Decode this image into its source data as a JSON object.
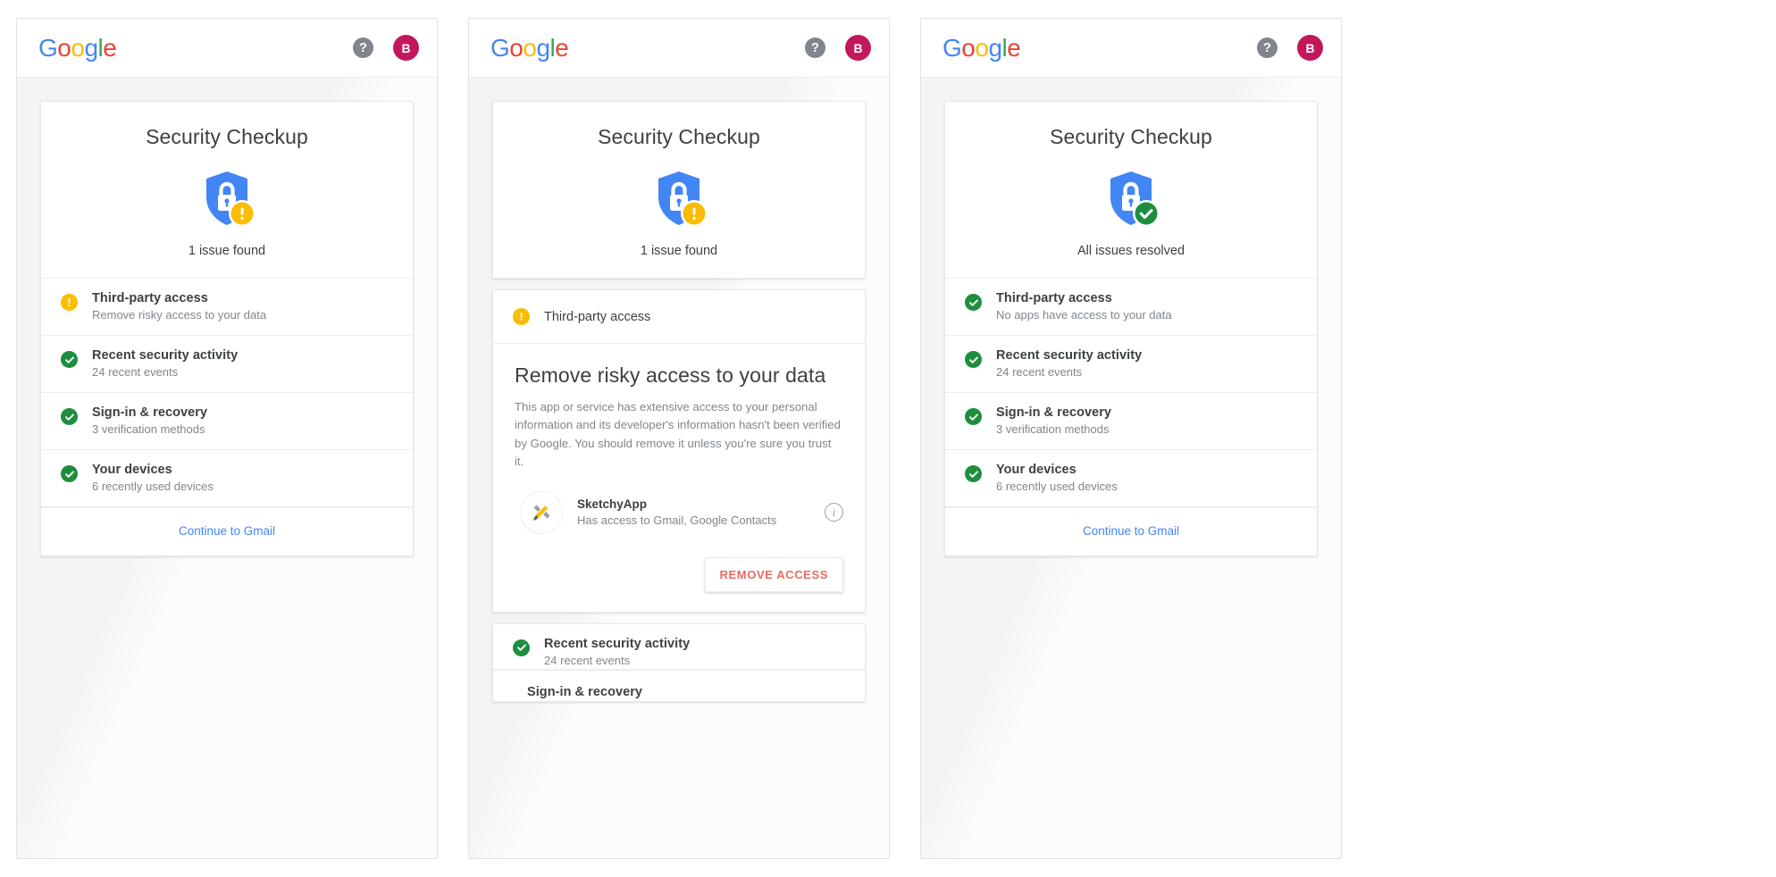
{
  "header": {
    "logo_letters": [
      "G",
      "o",
      "o",
      "g",
      "l",
      "e"
    ],
    "help_icon_glyph": "?",
    "avatar_initial": "B",
    "avatar_color": "#c2185b"
  },
  "colors": {
    "blue": "#4285F4",
    "red": "#EA4335",
    "yellow": "#FBBC05",
    "green": "#34A853",
    "warning": "#FBBC04",
    "success": "#1e8e3e",
    "link": "#4285F4",
    "danger_text": "#ea6a60",
    "page_bg": "#f4f4f4"
  },
  "panels": [
    {
      "id": "panel-overview-issue",
      "hero": {
        "title": "Security Checkup",
        "status_text": "1 issue found",
        "badge": "warning"
      },
      "items": [
        {
          "status": "warning",
          "title": "Third-party access",
          "desc": "Remove risky access to your data"
        },
        {
          "status": "ok",
          "title": "Recent security activity",
          "desc": "24 recent events"
        },
        {
          "status": "ok",
          "title": "Sign-in & recovery",
          "desc": "3 verification methods"
        },
        {
          "status": "ok",
          "title": "Your devices",
          "desc": "6 recently used devices"
        }
      ],
      "footer_link": "Continue to Gmail"
    },
    {
      "id": "panel-expanded-third-party",
      "hero": {
        "title": "Security Checkup",
        "status_text": "1 issue found",
        "badge": "warning"
      },
      "accordion": {
        "header_title": "Third-party access",
        "header_status": "warning",
        "heading": "Remove risky access to your data",
        "paragraph": "This app or service has extensive access to your personal information and its developer's information hasn't been verified by Google. You should remove it unless you're sure you trust it.",
        "app": {
          "name": "SketchyApp",
          "scope": "Has access to Gmail, Google Contacts",
          "icon": "paintbrush-icon",
          "info_glyph": "i"
        },
        "remove_button": "REMOVE ACCESS"
      },
      "items_below": [
        {
          "status": "ok",
          "title": "Recent security activity",
          "desc": "24 recent events"
        },
        {
          "status": "ok",
          "title": "Sign-in & recovery",
          "desc": ""
        }
      ]
    },
    {
      "id": "panel-overview-resolved",
      "hero": {
        "title": "Security Checkup",
        "status_text": "All issues resolved",
        "badge": "success"
      },
      "items": [
        {
          "status": "ok",
          "title": "Third-party access",
          "desc": "No apps have access to your data"
        },
        {
          "status": "ok",
          "title": "Recent security activity",
          "desc": "24 recent events"
        },
        {
          "status": "ok",
          "title": "Sign-in & recovery",
          "desc": "3 verification methods"
        },
        {
          "status": "ok",
          "title": "Your devices",
          "desc": "6 recently used devices"
        }
      ],
      "footer_link": "Continue to Gmail"
    }
  ]
}
